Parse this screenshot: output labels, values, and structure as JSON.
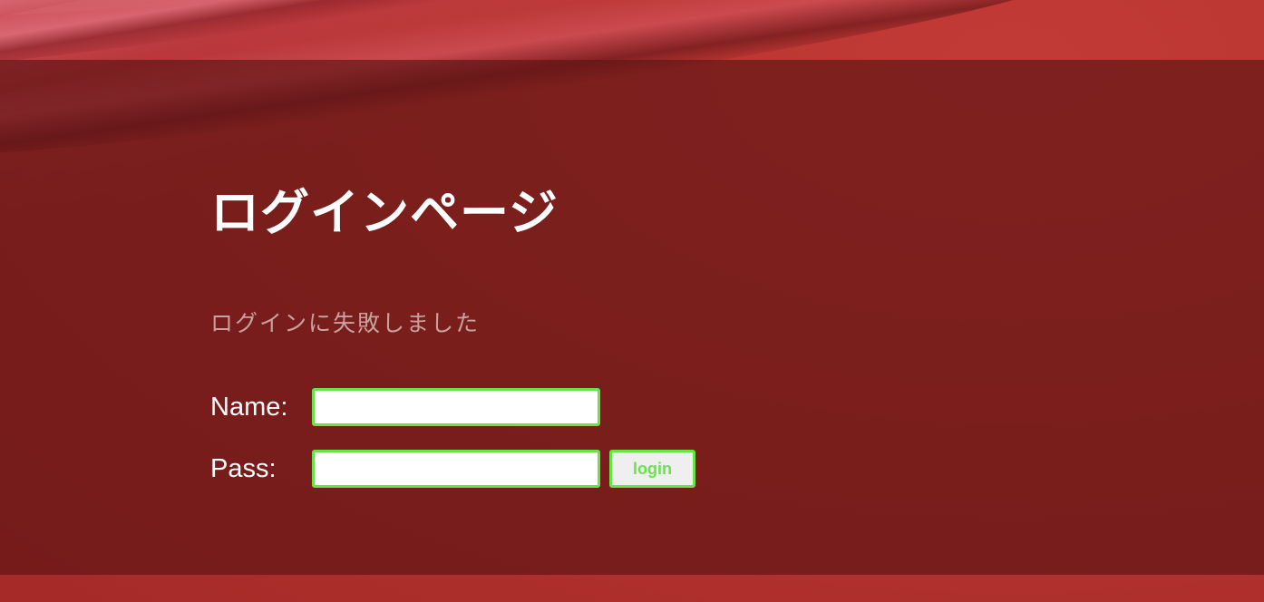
{
  "login_page": {
    "title": "ログインページ",
    "error_message": "ログインに失敗しました",
    "form": {
      "name_label": "Name:",
      "name_value": "",
      "pass_label": "Pass:",
      "pass_value": "",
      "login_button_label": "login"
    }
  },
  "colors": {
    "background_red": "#b73532",
    "overlay": "#5f1414",
    "field_border": "#66e44a",
    "button_text": "#66e44a",
    "error_text": "#c9a2a0"
  }
}
